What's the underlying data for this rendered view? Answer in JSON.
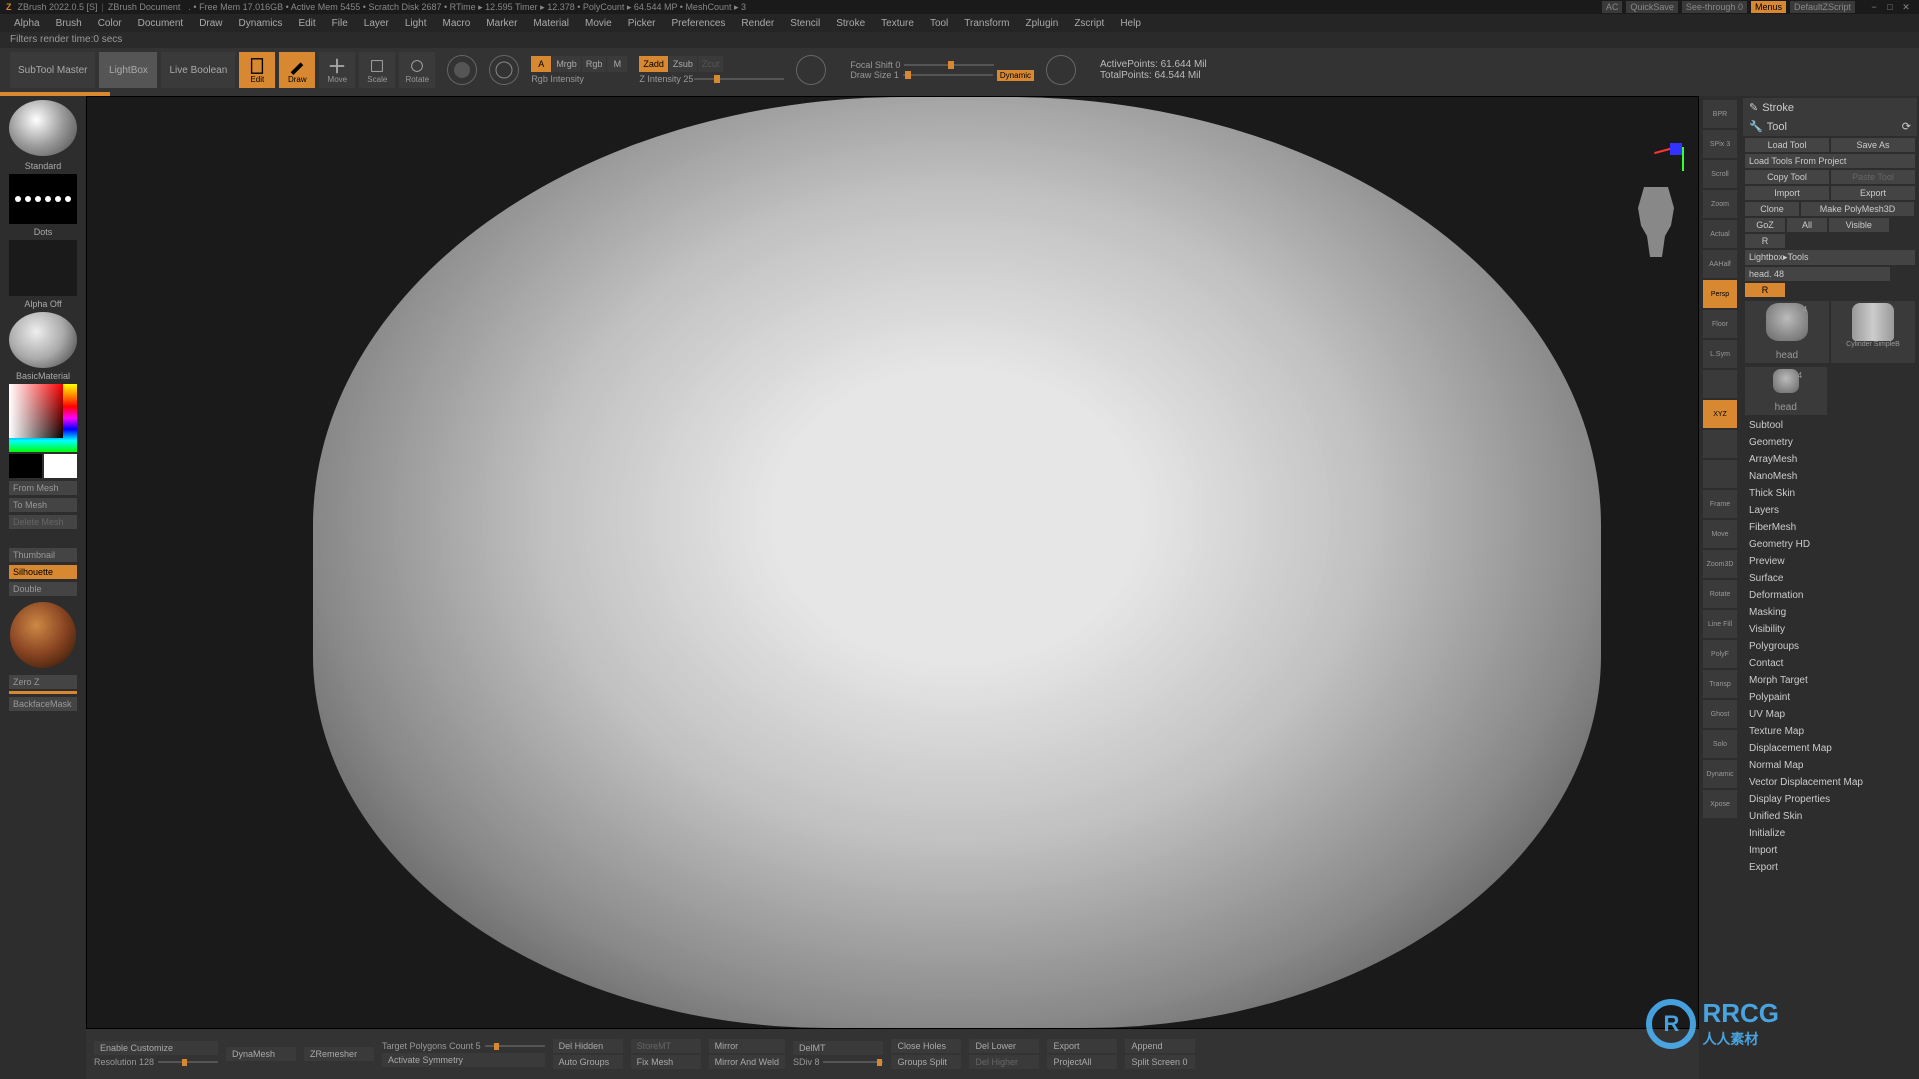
{
  "titlebar": {
    "app": "ZBrush 2022.0.5 [S]",
    "doc": "ZBrush Document",
    "stats": ". • Free Mem 17.016GB • Active Mem 5455 • Scratch Disk 2687 • RTime ▸ 12.595 Timer ▸ 12.378 • PolyCount ▸ 64.544 MP • MeshCount ▸ 3",
    "ac": "AC",
    "quicksave": "QuickSave",
    "seethrough": "See-through  0",
    "menus": "Menus",
    "defaultz": "DefaultZScript"
  },
  "menu": [
    "Alpha",
    "Brush",
    "Color",
    "Document",
    "Draw",
    "Dynamics",
    "Edit",
    "File",
    "Layer",
    "Light",
    "Macro",
    "Marker",
    "Material",
    "Movie",
    "Picker",
    "Preferences",
    "Render",
    "Stencil",
    "Stroke",
    "Texture",
    "Tool",
    "Transform",
    "Zplugin",
    "Zscript",
    "Help"
  ],
  "filter": "Filters render time:0 secs",
  "toolbar": {
    "subtool": "SubTool Master",
    "lightbox": "LightBox",
    "live": "Live Boolean",
    "edit": "Edit",
    "draw": "Draw",
    "move": "Move",
    "scale": "Scale",
    "rotate": "Rotate",
    "modes": {
      "a": "A",
      "mrgb": "Mrgb",
      "rgb": "Rgb",
      "m": "M",
      "zadd": "Zadd",
      "zsub": "Zsub",
      "zcut": "Zcut"
    },
    "rgb_int": "Rgb Intensity",
    "z_int": "Z Intensity 25",
    "focal": "Focal Shift 0",
    "drawsize": "Draw Size 1",
    "dynamic": "Dynamic",
    "active": "ActivePoints: 61.644 Mil",
    "total": "TotalPoints: 64.544 Mil"
  },
  "left": {
    "standard": "Standard",
    "dots": "Dots",
    "alpha": "Alpha Off",
    "material": "BasicMaterial",
    "frommesh": "From Mesh",
    "tomesh": "To Mesh",
    "delmesh": "Delete Mesh",
    "thumbnail": "Thumbnail",
    "silhouette": "Silhouette",
    "double": "Double",
    "zeroz": "Zero Z",
    "backface": "BackfaceMask"
  },
  "right_tools": [
    {
      "l": "BPR",
      "a": false
    },
    {
      "l": "SPix 3",
      "a": false
    },
    {
      "l": "Scroll",
      "a": false
    },
    {
      "l": "Zoom",
      "a": false
    },
    {
      "l": "Actual",
      "a": false
    },
    {
      "l": "AAHalf",
      "a": false
    },
    {
      "l": "Persp",
      "a": true
    },
    {
      "l": "Floor",
      "a": false
    },
    {
      "l": "L.Sym",
      "a": false
    },
    {
      "l": "",
      "a": false
    },
    {
      "l": "XYZ",
      "a": true
    },
    {
      "l": "",
      "a": false
    },
    {
      "l": "",
      "a": false
    },
    {
      "l": "Frame",
      "a": false
    },
    {
      "l": "Move",
      "a": false
    },
    {
      "l": "Zoom3D",
      "a": false
    },
    {
      "l": "Rotate",
      "a": false
    },
    {
      "l": "Line Fill",
      "a": false
    },
    {
      "l": "PolyF",
      "a": false
    },
    {
      "l": "Transp",
      "a": false
    },
    {
      "l": "Ghost",
      "a": false
    },
    {
      "l": "Solo",
      "a": false
    },
    {
      "l": "Dynamic",
      "a": false
    },
    {
      "l": "Xpose",
      "a": false
    }
  ],
  "right_panel": {
    "stroke": "Stroke",
    "tool": "Tool",
    "row1": [
      "Load Tool",
      "Save As"
    ],
    "row2": [
      "Load Tools From Project"
    ],
    "row3": [
      "Copy Tool",
      "Paste Tool"
    ],
    "row4": [
      "Import",
      "Export"
    ],
    "row5": [
      "Clone",
      "Make PolyMesh3D"
    ],
    "row6": [
      "GoZ",
      "All",
      "Visible",
      "R"
    ],
    "lightbox": "Lightbox▸Tools",
    "head": "head. 48",
    "r": "R",
    "sub_head": "head",
    "sub_head2": "head",
    "sub_cyl": "Cylinder SimpleB",
    "dot4": "4",
    "dot4b": "4",
    "sections": [
      "Subtool",
      "Geometry",
      "ArrayMesh",
      "NanoMesh",
      "Thick Skin",
      "Layers",
      "FiberMesh",
      "Geometry HD",
      "Preview",
      "Surface",
      "Deformation",
      "Masking",
      "Visibility",
      "Polygroups",
      "Contact",
      "Morph Target",
      "Polypaint",
      "UV Map",
      "Texture Map",
      "Displacement Map",
      "Normal Map",
      "Vector Displacement Map",
      "Display Properties",
      "Unified Skin",
      "Initialize",
      "Import",
      "Export"
    ]
  },
  "bottom": {
    "enable": "Enable Customize",
    "resolution": "Resolution 128",
    "dynamesh": "DynaMesh",
    "zremesher": "ZRemesher",
    "target": "Target Polygons Count 5",
    "activate": "Activate Symmetry",
    "delhidden": "Del Hidden",
    "autogroups": "Auto Groups",
    "storemt": "StoreMT",
    "fixmesh": "Fix Mesh",
    "mirror": "Mirror",
    "mirrorweld": "Mirror And Weld",
    "delmt": "DelMT",
    "sdiv": "SDiv 8",
    "closeholes": "Close Holes",
    "groupsplit": "Groups Split",
    "dellower": "Del Lower",
    "delhigher": "Del Higher",
    "export": "Export",
    "projectall": "ProjectAll",
    "append": "Append",
    "splitscreen": "Split Screen 0"
  },
  "watermark": {
    "text": "RRCG",
    "sub": "人人素材"
  }
}
